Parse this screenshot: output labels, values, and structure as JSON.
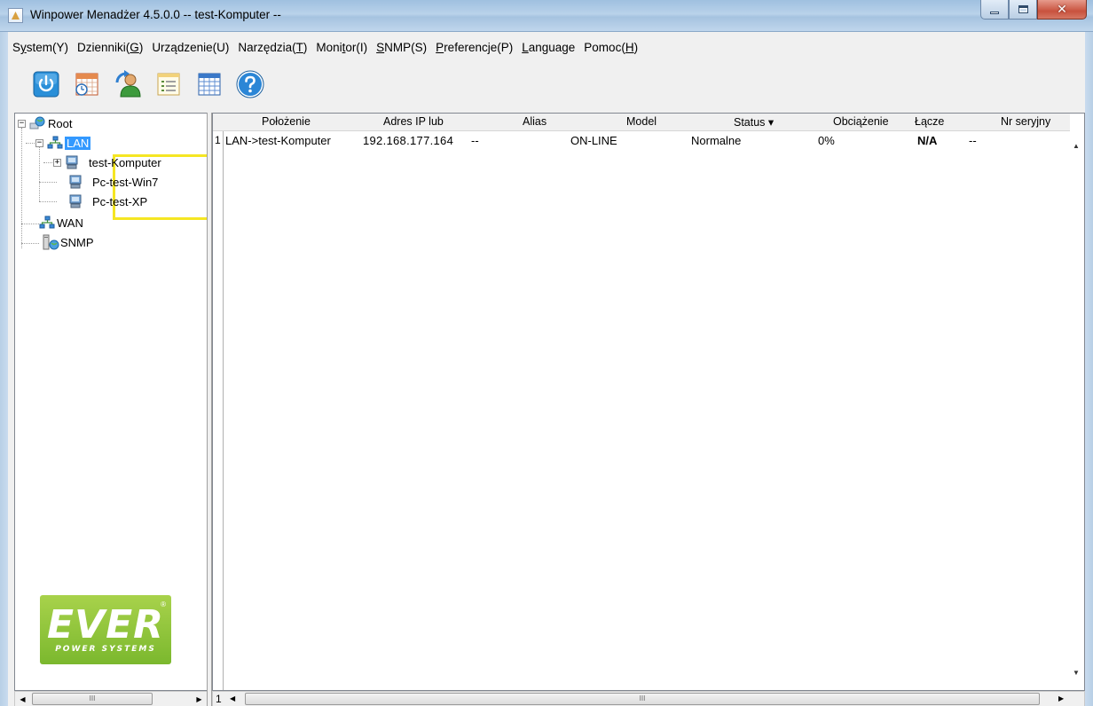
{
  "window": {
    "title": "Winpower Menadżer 4.5.0.0 -- test-Komputer --",
    "close_glyph": "✕"
  },
  "menu": [
    {
      "pre": "S",
      "u": "y",
      "post": "stem(Y)"
    },
    {
      "pre": "Dzienniki(",
      "u": "G",
      "post": ")"
    },
    {
      "pre": "Urządzenie(U)",
      "u": "",
      "post": ""
    },
    {
      "pre": "Narzędzia(",
      "u": "T",
      "post": ")"
    },
    {
      "pre": "Moni",
      "u": "t",
      "post": "or(I)"
    },
    {
      "pre": "",
      "u": "S",
      "post": "NMP(S)"
    },
    {
      "pre": "",
      "u": "P",
      "post": "referencje(P)"
    },
    {
      "pre": "",
      "u": "L",
      "post": "anguage"
    },
    {
      "pre": "Pomoc(",
      "u": "H",
      "post": ")"
    }
  ],
  "toolbar": [
    "power-icon",
    "schedule-icon",
    "user-refresh-icon",
    "list-icon",
    "table-icon",
    "help-icon"
  ],
  "tree": {
    "root": "Root",
    "lan": "LAN",
    "hosts": [
      "test-Komputer",
      "Pc-test-Win7",
      "Pc-test-XP"
    ],
    "wan": "WAN",
    "snmp": "SNMP"
  },
  "logo": {
    "main": "EVER",
    "sub": "POWER SYSTEMS",
    "registered": "®"
  },
  "table": {
    "columns": [
      "Położenie",
      "Adres IP lub",
      "Alias",
      "Model",
      "Status ▾",
      "Obciążenie",
      "Łącze",
      "Nr seryjny"
    ],
    "rows": [
      {
        "index": "1",
        "location": "LAN->test-Komputer",
        "ip": "192.168.177.164",
        "alias": "--",
        "model": "ON-LINE",
        "status": "Normalne",
        "load": "0%",
        "link": "N/A",
        "serial": "--"
      }
    ],
    "page_left": "1"
  },
  "scroll": {
    "left_arrow": "◀",
    "right_arrow": "▶",
    "up_arrow": "▲",
    "down_arrow": "▼",
    "grip": "III"
  },
  "colors": {
    "selection": "#3399ff",
    "highlight_box": "#f5e623",
    "logo_green": "#8cc43c"
  }
}
